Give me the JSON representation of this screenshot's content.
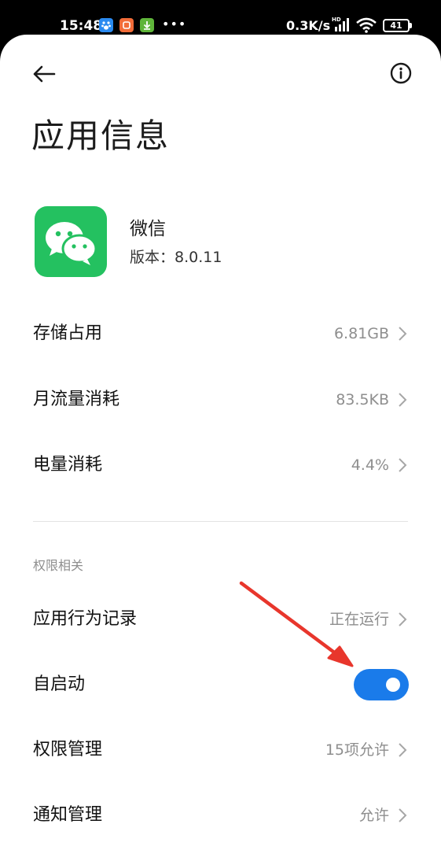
{
  "status_bar": {
    "time": "15:48",
    "more_dots": "•••",
    "net_speed": "0.3K/s",
    "signal_tag": "HD",
    "battery": "41",
    "icons": [
      "baidu-app-icon",
      "taobao-app-icon",
      "download-icon",
      "signal-icon",
      "wifi-icon",
      "battery-icon"
    ]
  },
  "header": {
    "back_icon": "arrow-left-icon",
    "info_icon": "info-circle-icon",
    "title": "应用信息"
  },
  "app": {
    "name": "微信",
    "version": "版本：8.0.11",
    "icon": "wechat-logo-icon",
    "icon_color": "#24c160"
  },
  "usage_rows": [
    {
      "label": "存储占用",
      "value": "6.81GB"
    },
    {
      "label": "月流量消耗",
      "value": "83.5KB"
    },
    {
      "label": "电量消耗",
      "value": "4.4%"
    }
  ],
  "permissions": {
    "section_title": "权限相关",
    "behavior_record": {
      "label": "应用行为记录",
      "value": "正在运行"
    },
    "autostart": {
      "label": "自启动",
      "enabled": true
    },
    "permission_mgmt": {
      "label": "权限管理",
      "value": "15项允许"
    },
    "notification_mgmt": {
      "label": "通知管理",
      "value": "允许"
    }
  },
  "colors": {
    "accent": "#1a7bea",
    "annotation_arrow": "#e8362c",
    "secondary_text": "#8e8e8e"
  }
}
